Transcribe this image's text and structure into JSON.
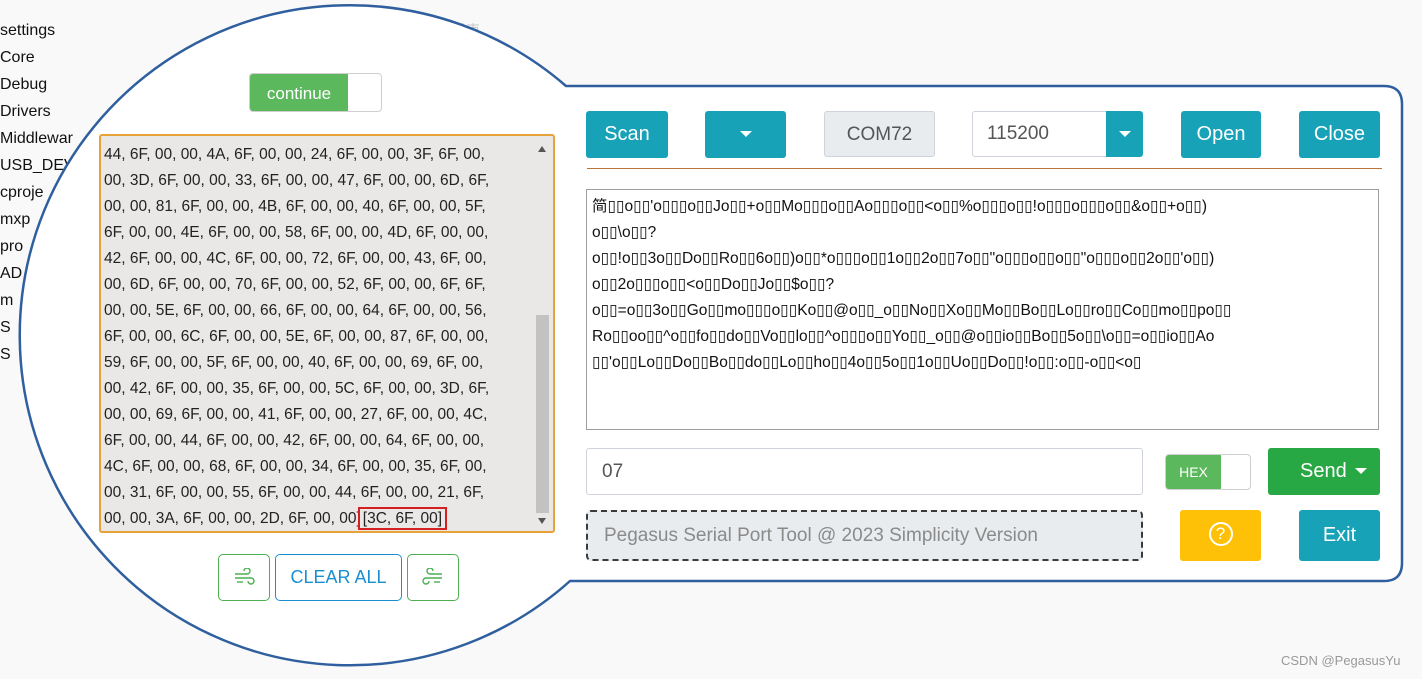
{
  "sidebar": [
    "settings",
    "Core",
    "Debug",
    "Drivers",
    "Middlewar",
    "USB_DEV",
    "cproje",
    "mxp",
    "pro",
    "AD",
    "m",
    "S",
    "S"
  ],
  "ghost_text": "措束",
  "left_panel": {
    "continue_label": "continue",
    "hex_lines": [
      "44, 6F, 00, 00, 4A, 6F, 00, 00, 24, 6F, 00, 00, 3F, 6F, 00,",
      "00, 3D, 6F, 00, 00, 33, 6F, 00, 00, 47, 6F, 00, 00, 6D, 6F,",
      "00, 00, 81, 6F, 00, 00, 4B, 6F, 00, 00, 40, 6F, 00, 00, 5F,",
      "6F, 00, 00, 4E, 6F, 00, 00, 58, 6F, 00, 00, 4D, 6F, 00, 00,",
      "42, 6F, 00, 00, 4C, 6F, 00, 00, 72, 6F, 00, 00, 43, 6F, 00,",
      "00, 6D, 6F, 00, 00, 70, 6F, 00, 00, 52, 6F, 00, 00, 6F, 6F,",
      "00, 00, 5E, 6F, 00, 00, 66, 6F, 00, 00, 64, 6F, 00, 00, 56,",
      "6F, 00, 00, 6C, 6F, 00, 00, 5E, 6F, 00, 00, 87, 6F, 00, 00,",
      "59, 6F, 00, 00, 5F, 6F, 00, 00, 40, 6F, 00, 00, 69, 6F, 00,",
      "00, 42, 6F, 00, 00, 35, 6F, 00, 00, 5C, 6F, 00, 00, 3D, 6F,",
      "00, 00, 69, 6F, 00, 00, 41, 6F, 00, 00, 27, 6F, 00, 00, 4C,",
      "6F, 00, 00, 44, 6F, 00, 00, 42, 6F, 00, 00, 64, 6F, 00, 00,",
      "4C, 6F, 00, 00, 68, 6F, 00, 00, 34, 6F, 00, 00, 35, 6F, 00,",
      "00, 31, 6F, 00, 00, 55, 6F, 00, 00, 44, 6F, 00, 00, 21, 6F,"
    ],
    "last_line": "00, 00, 3A, 6F, 00, 00, 2D, 6F, 00, 00]",
    "last_highlight": "[3C, 6F, 00]",
    "clear_all": "CLEAR ALL"
  },
  "toolbar": {
    "scan": "Scan",
    "port": "COM72",
    "baud": "115200",
    "open": "Open",
    "close": "Close"
  },
  "receive_lines": [
    "简▯▯o▯▯'o▯▯▯o▯▯Jo▯▯+o▯▯Mo▯▯▯o▯▯Ao▯▯▯o▯▯<o▯▯%o▯▯▯o▯▯!o▯▯▯o▯▯▯o▯▯&o▯▯+o▯▯)",
    "o▯▯\\o▯▯?",
    "o▯▯!o▯▯3o▯▯Do▯▯Ro▯▯6o▯▯)o▯▯*o▯▯▯o▯▯1o▯▯2o▯▯7o▯▯\"o▯▯▯o▯▯o▯▯\"o▯▯▯o▯▯2o▯▯'o▯▯)",
    "o▯▯2o▯▯▯o▯▯<o▯▯Do▯▯Jo▯▯$o▯▯?",
    "o▯▯=o▯▯3o▯▯Go▯▯mo▯▯▯o▯▯Ko▯▯@o▯▯_o▯▯No▯▯Xo▯▯Mo▯▯Bo▯▯Lo▯▯ro▯▯Co▯▯mo▯▯po▯▯",
    "Ro▯▯oo▯▯^o▯▯fo▯▯do▯▯Vo▯▯lo▯▯^o▯▯▯o▯▯Yo▯▯_o▯▯@o▯▯io▯▯Bo▯▯5o▯▯\\o▯▯=o▯▯io▯▯Ao",
    "▯▯'o▯▯Lo▯▯Do▯▯Bo▯▯do▯▯Lo▯▯ho▯▯4o▯▯5o▯▯1o▯▯Uo▯▯Do▯▯!o▯▯:o▯▯-o▯▯<o▯"
  ],
  "send": {
    "value": "07",
    "hex_label": "HEX",
    "send_label": "Send"
  },
  "footer": {
    "title": "Pegasus Serial Port Tool @ 2023 Simplicity Version",
    "help_glyph": "?",
    "exit": "Exit"
  },
  "watermark": "CSDN @PegasusYu",
  "colors": {
    "teal": "#17a2b8",
    "green": "#28a745",
    "toggle_green": "#5cb85c",
    "yellow": "#ffc107",
    "bubble_border": "#2f5f9e",
    "hex_border": "#e7a33a",
    "highlight": "#d42020"
  }
}
